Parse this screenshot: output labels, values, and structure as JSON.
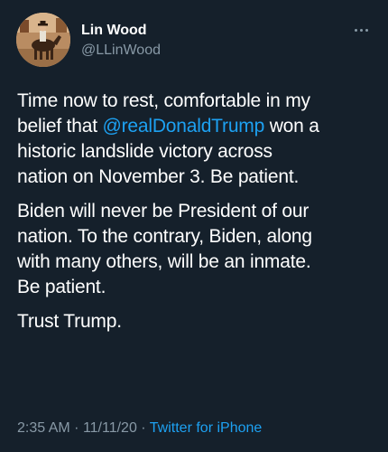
{
  "tweet": {
    "author": {
      "display_name": "Lin Wood",
      "handle": "@LLinWood",
      "avatar_icon": "avatar-horse-rider"
    },
    "more_icon": "more-horizontal-icon",
    "paragraph1": {
      "line1": "Time now to rest, comfortable in my",
      "line2_pre": "belief that ",
      "line2_mention": "@realDonaldTrump",
      "line2_post": " won a",
      "line3": "historic landslide victory across",
      "line4": "nation on November 3. Be patient."
    },
    "paragraph2": {
      "line1": "Biden will never be President of our",
      "line2": "nation. To the contrary, Biden, along",
      "line3": "with many others, will be an inmate.",
      "line4": "Be patient."
    },
    "paragraph3": {
      "line1": "Trust Trump."
    },
    "meta": {
      "time": "2:35 AM",
      "separator": "·",
      "date": "11/11/20",
      "source": "Twitter for iPhone"
    },
    "colors": {
      "background": "#15202b",
      "text": "#ffffff",
      "secondary": "#8899a6",
      "link": "#1da1f2"
    }
  }
}
